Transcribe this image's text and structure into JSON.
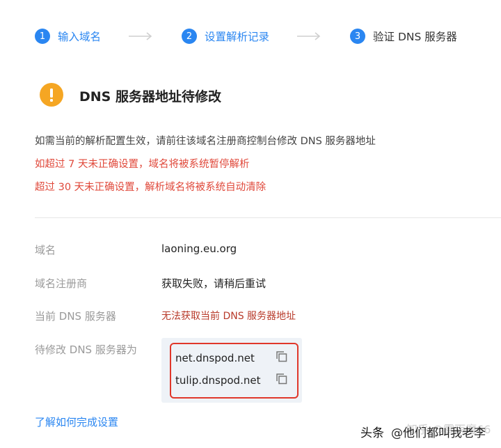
{
  "steps": [
    {
      "number": "1",
      "label": "输入域名"
    },
    {
      "number": "2",
      "label": "设置解析记录"
    },
    {
      "number": "3",
      "label": "验证 DNS 服务器"
    }
  ],
  "colors": {
    "accent": "#2a86f1",
    "warning": "#f5a623",
    "error": "#e0493b",
    "highlight_border": "#e0372a"
  },
  "warning": {
    "icon": "exclamation-circle-icon",
    "title": "DNS 服务器地址待修改"
  },
  "description": {
    "line1": "如需当前的解析配置生效，请前往该域名注册商控制台修改 DNS 服务器地址",
    "line2": "如超过 7 天未正确设置，域名将被系统暂停解析",
    "line3": "超过 30 天未正确设置，解析域名将被系统自动清除"
  },
  "details": {
    "domain_label": "域名",
    "domain_value": "laoning.eu.org",
    "registrar_label": "域名注册商",
    "registrar_value": "获取失败，请稍后重试",
    "current_dns_label": "当前 DNS 服务器",
    "current_dns_value": "无法获取当前 DNS 服务器地址",
    "target_dns_label": "待修改 DNS 服务器为",
    "target_dns": [
      "net.dnspod.net",
      "tulip.dnspod.net"
    ]
  },
  "help_link": "了解如何完成设置",
  "watermark": {
    "prefix": "头条",
    "author": "@他们都叫我老李",
    "overlay": "知乎 @雾雨魔66"
  }
}
